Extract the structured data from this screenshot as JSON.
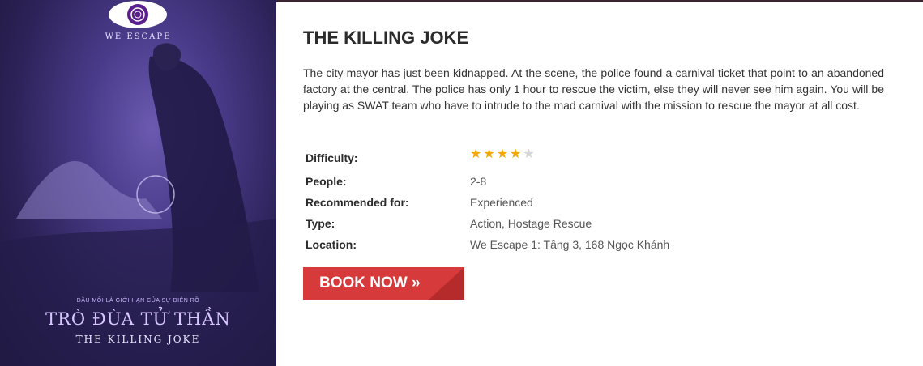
{
  "poster": {
    "brand": "WE ESCAPE",
    "tagline": "ĐẦU MỐI LÀ GIỚI HẠN CỦA SỰ ĐIÊN RỒ",
    "title_vn": "TRÒ ĐÙA TỬ THẦN",
    "title_en": "THE KILLING JOKE"
  },
  "room": {
    "title": "THE KILLING JOKE",
    "description": "The city mayor has just been kidnapped. At the scene, the police found a carnival ticket that point to an abandoned factory at the central. The police has only 1 hour to rescue the victim, else they will never see him again. You will be playing as SWAT team who have to intrude to the mad carnival with the mission to rescue the mayor at all cost."
  },
  "specs": {
    "difficulty_label": "Difficulty:",
    "difficulty_rating": 4,
    "difficulty_max": 5,
    "people_label": "People:",
    "people_value": "2-8",
    "recommended_label": "Recommended for:",
    "recommended_value": "Experienced",
    "type_label": "Type:",
    "type_value": "Action, Hostage Rescue",
    "location_label": "Location:",
    "location_value": "We Escape 1: Tầng 3, 168 Ngọc Khánh"
  },
  "actions": {
    "book_label": "BOOK NOW »"
  },
  "colors": {
    "accent": "#d63a3a",
    "star_on": "#f4a900",
    "star_off": "#d6d6d6"
  },
  "icons": {
    "star": "star-icon",
    "logo": "eye-logo-icon"
  }
}
